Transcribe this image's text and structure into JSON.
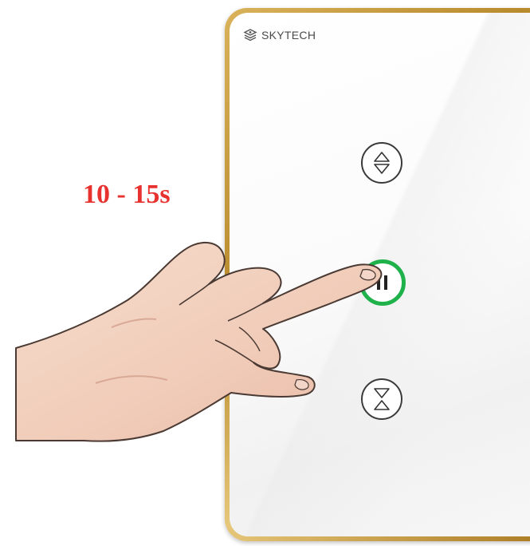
{
  "brand": {
    "name": "SKYTECH"
  },
  "hint": {
    "duration_text": "10 - 15s"
  },
  "buttons": {
    "open_icon": "up-down-triangle-icon",
    "stop_icon": "pause-icon",
    "close_icon": "down-up-triangle-icon",
    "active_ring_color": "#1fb14a"
  },
  "colors": {
    "frame": "#c49a3e",
    "hint": "#e8322f"
  }
}
